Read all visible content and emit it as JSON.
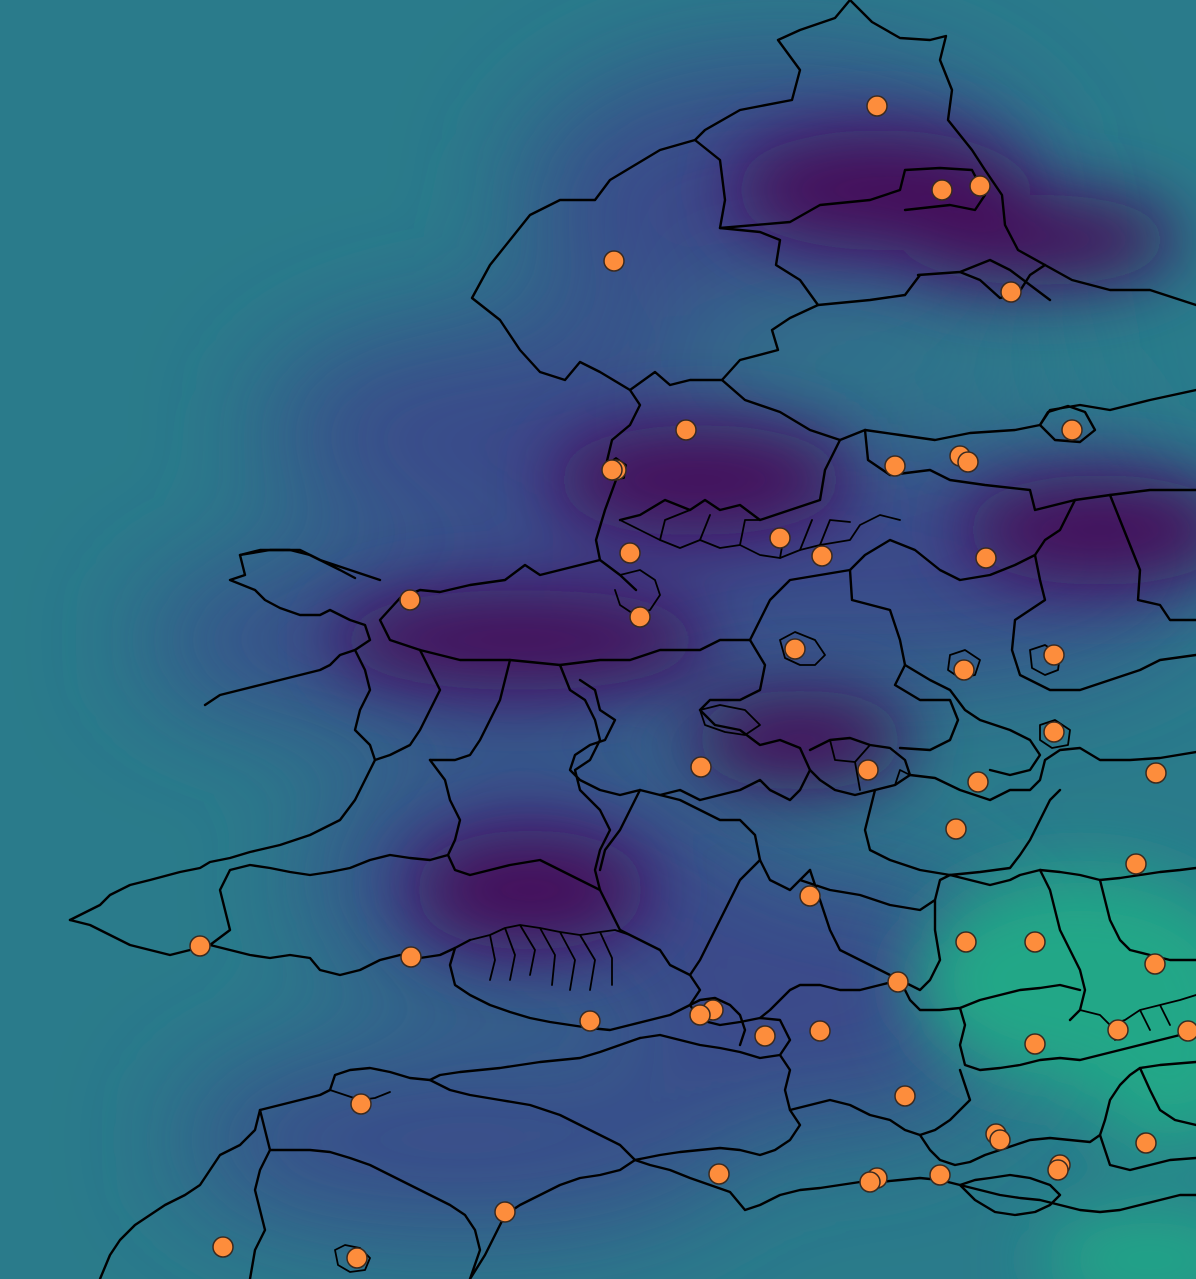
{
  "map": {
    "type": "interpolated surface with region boundaries and point sites",
    "colormap": "viridis",
    "colors": {
      "background": "#2a7b8b",
      "low_value": "#440e5a",
      "mid_low": "#3b4a8a",
      "mid": "#2a7b8b",
      "high_value": "#22a787",
      "boundary": "#000000",
      "site_marker": "#fd8d3c"
    },
    "site_count": 57,
    "legend": "none",
    "title": "",
    "axes": "none"
  }
}
